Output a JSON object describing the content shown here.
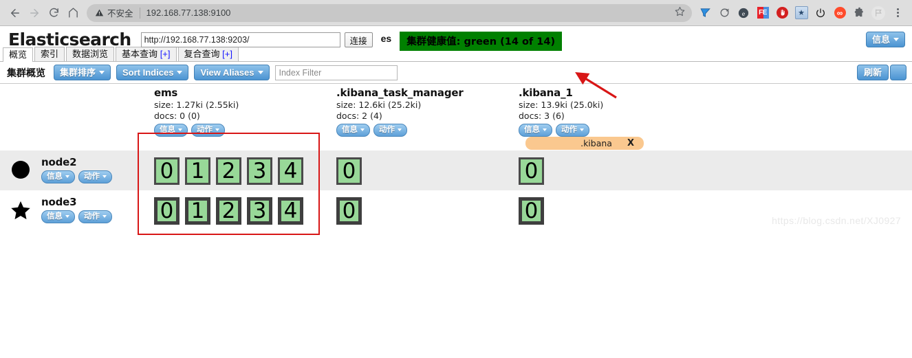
{
  "browser": {
    "back_icon": "arrow-back-icon",
    "forward_icon": "arrow-forward-icon",
    "reload_icon": "reload-icon",
    "home_icon": "home-icon",
    "security_label": "不安全",
    "url": "192.168.77.138:9100",
    "bookmark_icon": "star-icon",
    "extensions": [
      {
        "name": "yandex-extension-icon",
        "glyph": "▼"
      },
      {
        "name": "sync-extension-icon",
        "glyph": "↻"
      },
      {
        "name": "edge-extension-icon",
        "glyph": "e"
      },
      {
        "name": "fe-extension-icon",
        "glyph": "FE"
      },
      {
        "name": "adblock-extension-icon",
        "glyph": "✋"
      },
      {
        "name": "bookmark-extension-icon",
        "glyph": "★"
      },
      {
        "name": "power-extension-icon",
        "glyph": "⏻"
      },
      {
        "name": "infinity-extension-icon",
        "glyph": "∞"
      },
      {
        "name": "puzzle-extension-icon",
        "glyph": "🧩"
      },
      {
        "name": "flag-extension-icon",
        "glyph": "⚑"
      }
    ],
    "menu_icon": "kebab-menu-icon"
  },
  "app": {
    "logo": "Elasticsearch",
    "host_value": "http://192.168.77.138:9203/",
    "host_placeholder": "",
    "connect_label": "连接",
    "cluster_name": "es",
    "health_text": "集群健康值: green (14 of 14)",
    "health_color": "#008000",
    "info_button_label": "信息",
    "tabs": [
      {
        "label": "概览",
        "suffix": "",
        "active": true
      },
      {
        "label": "索引",
        "suffix": "",
        "active": false
      },
      {
        "label": "数据浏览",
        "suffix": "",
        "active": false
      },
      {
        "label": "基本查询",
        "suffix": "[+]",
        "active": false
      },
      {
        "label": "复合查询",
        "suffix": "[+]",
        "active": false
      }
    ]
  },
  "controls": {
    "section_title": "集群概览",
    "cluster_sort_label": "集群排序",
    "sort_indices_label": "Sort Indices",
    "view_aliases_label": "View Aliases",
    "index_filter_value": "",
    "index_filter_placeholder": "Index Filter",
    "refresh_label": "刷新"
  },
  "buttons": {
    "info_label": "信息",
    "action_label": "动作"
  },
  "indices": [
    {
      "name": "ems",
      "size": "size: 1.27ki (2.55ki)",
      "docs": "docs: 0 (0)",
      "alias": null
    },
    {
      "name": ".kibana_task_manager",
      "size": "size: 12.6ki (25.2ki)",
      "docs": "docs: 2 (4)",
      "alias": null
    },
    {
      "name": ".kibana_1",
      "size": "size: 13.9ki (25.0ki)",
      "docs": "docs: 3 (6)",
      "alias": ".kibana",
      "alias_close": "X"
    }
  ],
  "nodes": [
    {
      "name": "node2",
      "icon": "circle-node-icon",
      "shards": [
        {
          "index": "ems",
          "values": [
            "0",
            "1",
            "2",
            "3",
            "4"
          ],
          "type": "replica"
        },
        {
          "index": ".kibana_task_manager",
          "values": [
            "0"
          ],
          "type": "replica"
        },
        {
          "index": ".kibana_1",
          "values": [
            "0"
          ],
          "type": "replica"
        }
      ]
    },
    {
      "name": "node3",
      "icon": "star-node-icon",
      "shards": [
        {
          "index": "ems",
          "values": [
            "0",
            "1",
            "2",
            "3",
            "4"
          ],
          "type": "primary"
        },
        {
          "index": ".kibana_task_manager",
          "values": [
            "0"
          ],
          "type": "primary"
        },
        {
          "index": ".kibana_1",
          "values": [
            "0"
          ],
          "type": "primary"
        }
      ]
    }
  ],
  "annotations": {
    "highlight_color": "#d81616",
    "arrow_color": "#d81616"
  },
  "watermark": "https://blog.csdn.net/XJ0927"
}
